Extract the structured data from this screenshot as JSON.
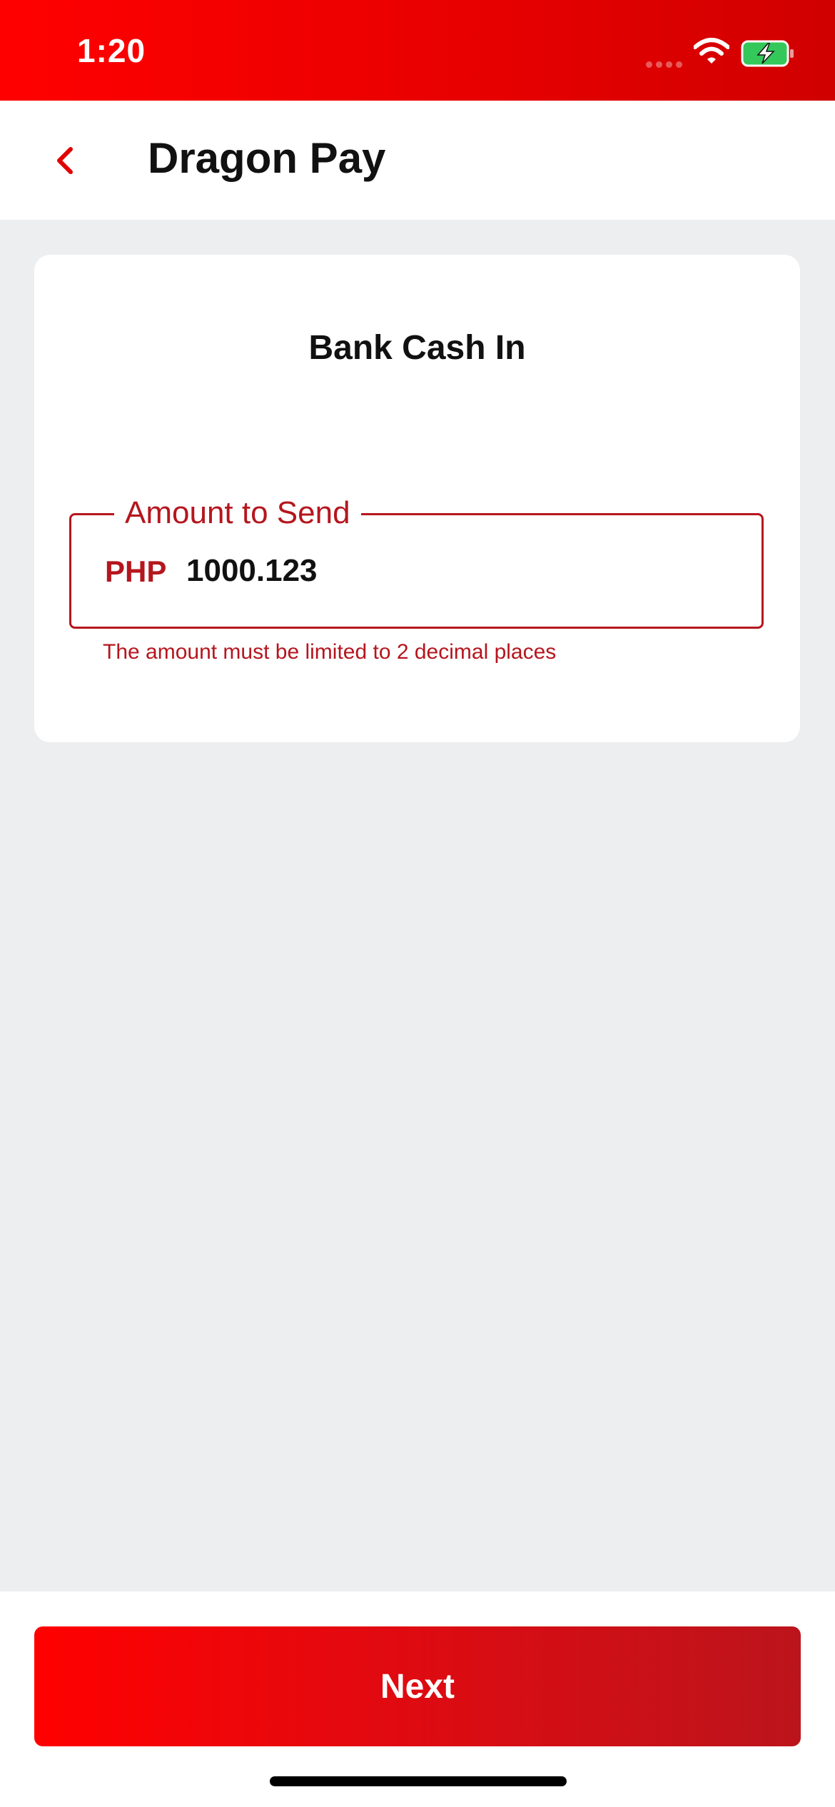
{
  "status_bar": {
    "time": "1:20",
    "wifi_icon": "wifi-icon",
    "battery_icon": "battery-charging-icon"
  },
  "nav": {
    "back_icon": "chevron-left-icon",
    "title": "Dragon Pay"
  },
  "card": {
    "title": "Bank Cash In",
    "amount_field": {
      "label": "Amount to Send",
      "currency": "PHP",
      "value": "1000.123",
      "error": "The amount must be limited to 2 decimal places"
    }
  },
  "actions": {
    "next_label": "Next"
  },
  "colors": {
    "brand_red": "#FF0000",
    "error_red": "#B5161E",
    "background": "#EDEEF0"
  }
}
